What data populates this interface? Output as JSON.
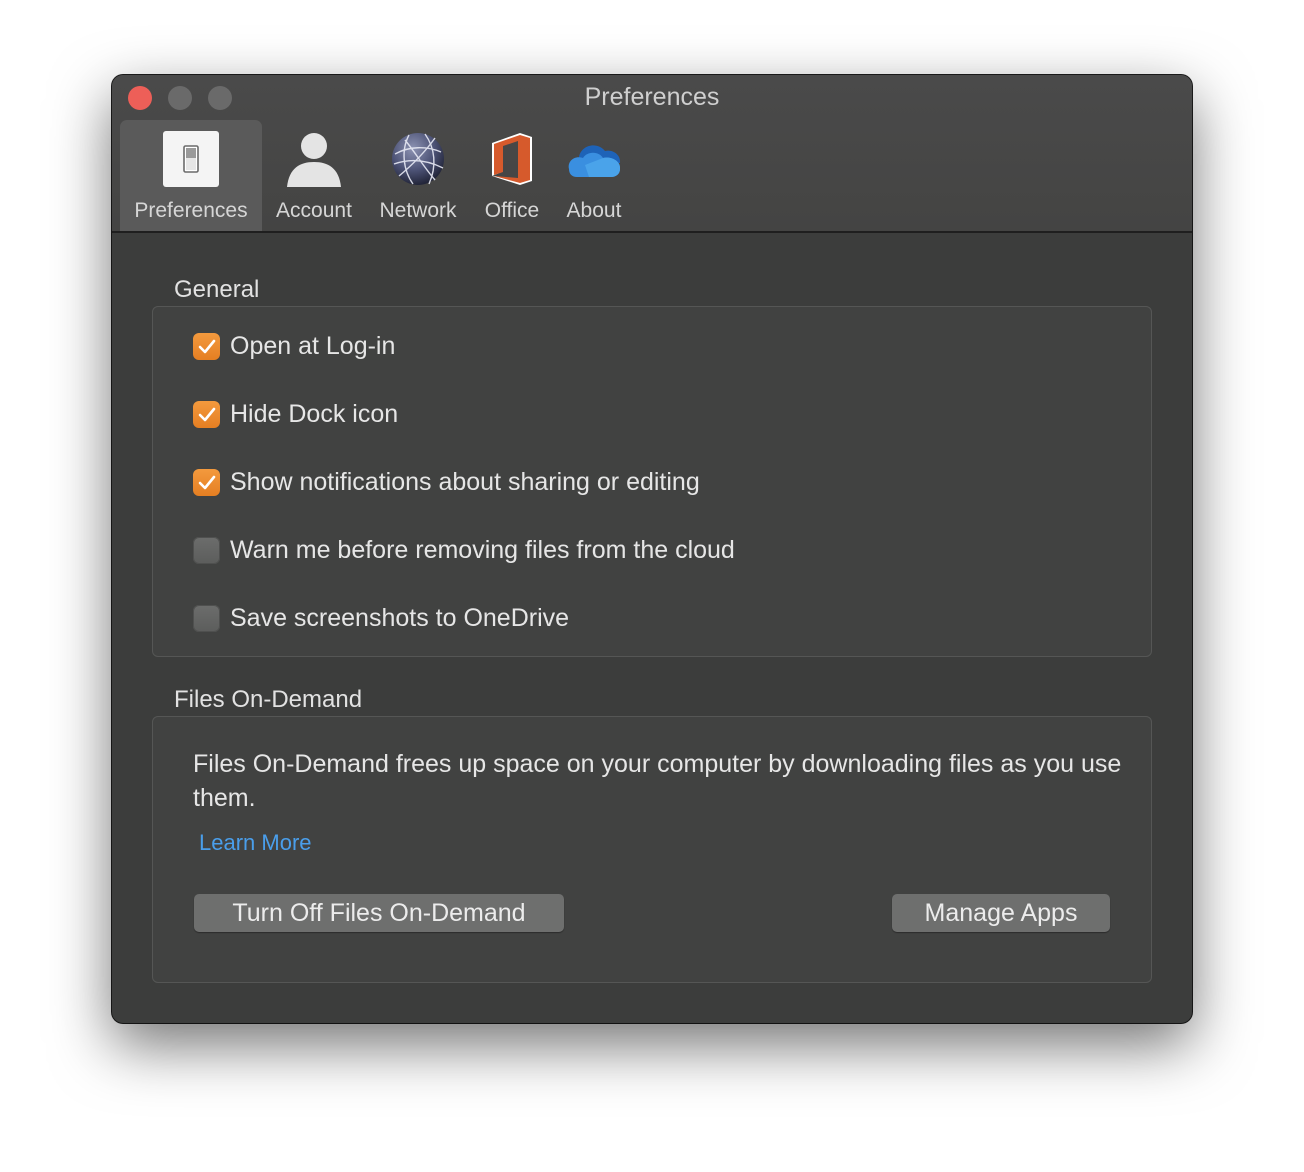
{
  "window": {
    "title": "Preferences",
    "traffic_lights": {
      "close": {
        "name": "close-button",
        "color": "#ed5f58"
      },
      "minimize": {
        "name": "minimize-button",
        "color": "#6a6a6a"
      },
      "zoom": {
        "name": "zoom-button",
        "color": "#6a6a6a"
      }
    }
  },
  "toolbar": {
    "tabs": [
      {
        "label": "Preferences",
        "icon": "switch-icon",
        "active": true
      },
      {
        "label": "Account",
        "icon": "person-icon",
        "active": false
      },
      {
        "label": "Network",
        "icon": "globe-network-icon",
        "active": false
      },
      {
        "label": "Office",
        "icon": "office-logo-icon",
        "active": false
      },
      {
        "label": "About",
        "icon": "onedrive-cloud-icon",
        "active": false
      }
    ]
  },
  "general": {
    "title": "General",
    "options": [
      {
        "label": "Open at Log-in",
        "checked": true
      },
      {
        "label": "Hide Dock icon",
        "checked": true
      },
      {
        "label": "Show notifications about sharing or editing",
        "checked": true
      },
      {
        "label": "Warn me before removing files from the cloud",
        "checked": false
      },
      {
        "label": "Save screenshots to OneDrive",
        "checked": false
      }
    ]
  },
  "files_on_demand": {
    "title": "Files On-Demand",
    "description": "Files On-Demand frees up space on your computer by downloading files as you use them.",
    "learn_more": "Learn More",
    "turn_off_button": "Turn Off Files On-Demand",
    "manage_apps_button": "Manage Apps"
  },
  "colors": {
    "accent_checkbox": "#f0923a",
    "link": "#4a9eea",
    "window_bg": "#3c3d3c"
  }
}
